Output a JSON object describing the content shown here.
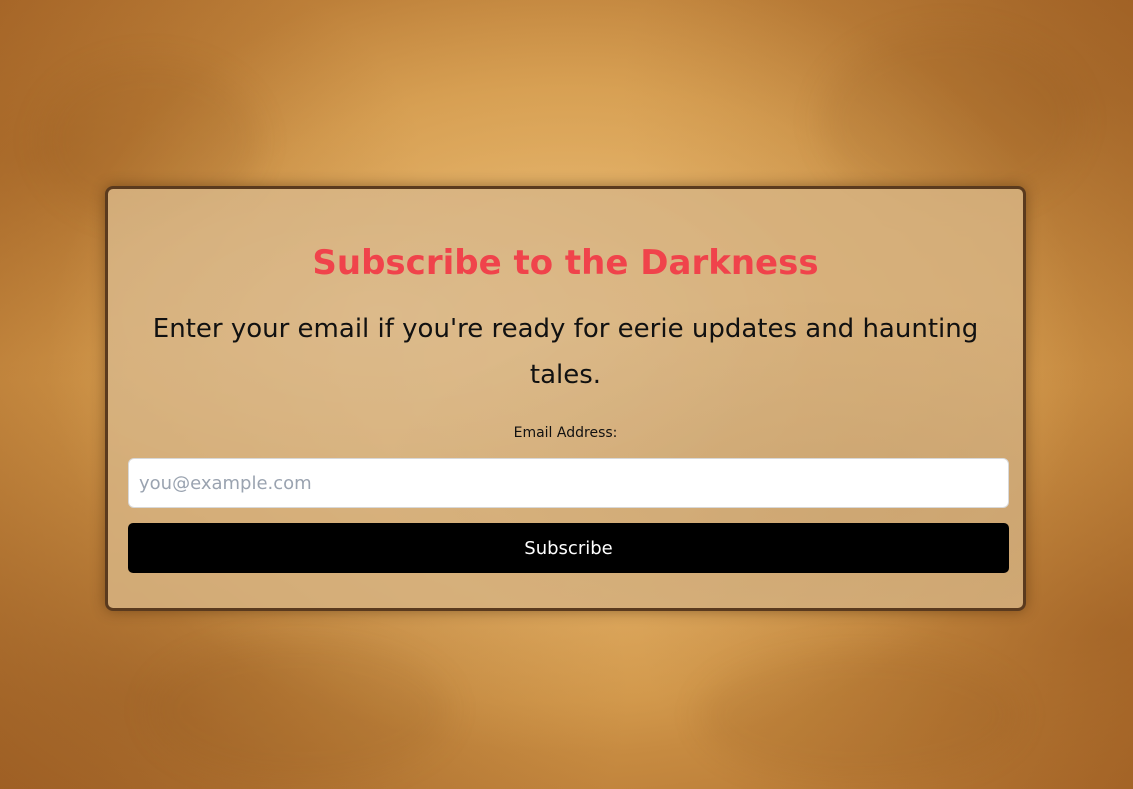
{
  "signup": {
    "title": "Subscribe to the Darkness",
    "subtitle": "Enter your email if you're ready for eerie updates and haunting tales.",
    "email_label": "Email Address:",
    "email_placeholder": "you@example.com",
    "email_value": "",
    "button_label": "Subscribe"
  },
  "colors": {
    "title": "#f0434b",
    "button_bg": "#000000",
    "button_text": "#ffffff",
    "card_border": "#5a3a1e",
    "page_background": "#cf9447"
  }
}
